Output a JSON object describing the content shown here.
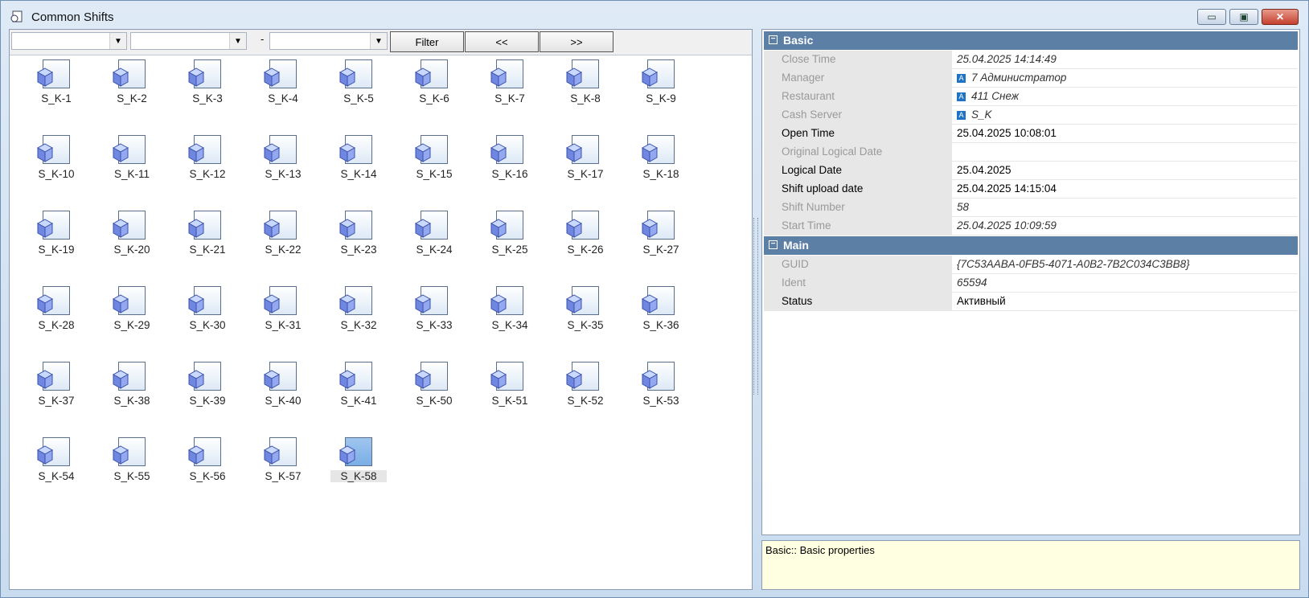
{
  "window": {
    "title": "Common Shifts",
    "min_glyph": "▭",
    "max_glyph": "▣",
    "close_glyph": "✕"
  },
  "toolbar": {
    "combo1_value": "",
    "combo2_value": "",
    "combo3_value": "",
    "dash": "-",
    "filter_label": "Filter",
    "prev_label": "<<",
    "next_label": ">>"
  },
  "shifts": [
    "S_K-1",
    "S_K-2",
    "S_K-3",
    "S_K-4",
    "S_K-5",
    "S_K-6",
    "S_K-7",
    "S_K-8",
    "S_K-9",
    "S_K-10",
    "S_K-11",
    "S_K-12",
    "S_K-13",
    "S_K-14",
    "S_K-15",
    "S_K-16",
    "S_K-17",
    "S_K-18",
    "S_K-19",
    "S_K-20",
    "S_K-21",
    "S_K-22",
    "S_K-23",
    "S_K-24",
    "S_K-25",
    "S_K-26",
    "S_K-27",
    "S_K-28",
    "S_K-29",
    "S_K-30",
    "S_K-31",
    "S_K-32",
    "S_K-33",
    "S_K-34",
    "S_K-35",
    "S_K-36",
    "S_K-37",
    "S_K-38",
    "S_K-39",
    "S_K-40",
    "S_K-41",
    "S_K-50",
    "S_K-51",
    "S_K-52",
    "S_K-53",
    "S_K-54",
    "S_K-55",
    "S_K-56",
    "S_K-57",
    "S_K-58"
  ],
  "selected_shift": "S_K-58",
  "properties": {
    "categories": [
      {
        "name": "Basic",
        "toggle": "−",
        "rows": [
          {
            "name": "Close Time",
            "value": "25.04.2025 14:14:49",
            "editable": false,
            "ref": false
          },
          {
            "name": "Manager",
            "value": "7 Администратор",
            "editable": false,
            "ref": true
          },
          {
            "name": "Restaurant",
            "value": "411 Снеж",
            "editable": false,
            "ref": true
          },
          {
            "name": "Cash Server",
            "value": "S_K",
            "editable": false,
            "ref": true
          },
          {
            "name": "Open Time",
            "value": "25.04.2025 10:08:01",
            "editable": true,
            "ref": false
          },
          {
            "name": "Original Logical Date",
            "value": "",
            "editable": false,
            "ref": false
          },
          {
            "name": "Logical Date",
            "value": "25.04.2025",
            "editable": true,
            "ref": false
          },
          {
            "name": "Shift upload date",
            "value": "25.04.2025 14:15:04",
            "editable": true,
            "ref": false
          },
          {
            "name": "Shift Number",
            "value": "58",
            "editable": false,
            "ref": false
          },
          {
            "name": "Start Time",
            "value": "25.04.2025 10:09:59",
            "editable": false,
            "ref": false
          }
        ]
      },
      {
        "name": "Main",
        "toggle": "−",
        "rows": [
          {
            "name": "GUID",
            "value": "{7C53AABA-0FB5-4071-A0B2-7B2C034C3BB8}",
            "editable": false,
            "ref": false
          },
          {
            "name": "Ident",
            "value": "65594",
            "editable": false,
            "ref": false
          },
          {
            "name": "Status",
            "value": "Активный",
            "editable": true,
            "ref": false
          }
        ]
      }
    ],
    "ref_glyph": "A"
  },
  "description": "Basic:: Basic properties",
  "colors": {
    "category_header": "#5c7fa6",
    "ref_icon": "#1f73c4",
    "description_bg": "#ffffe1"
  }
}
